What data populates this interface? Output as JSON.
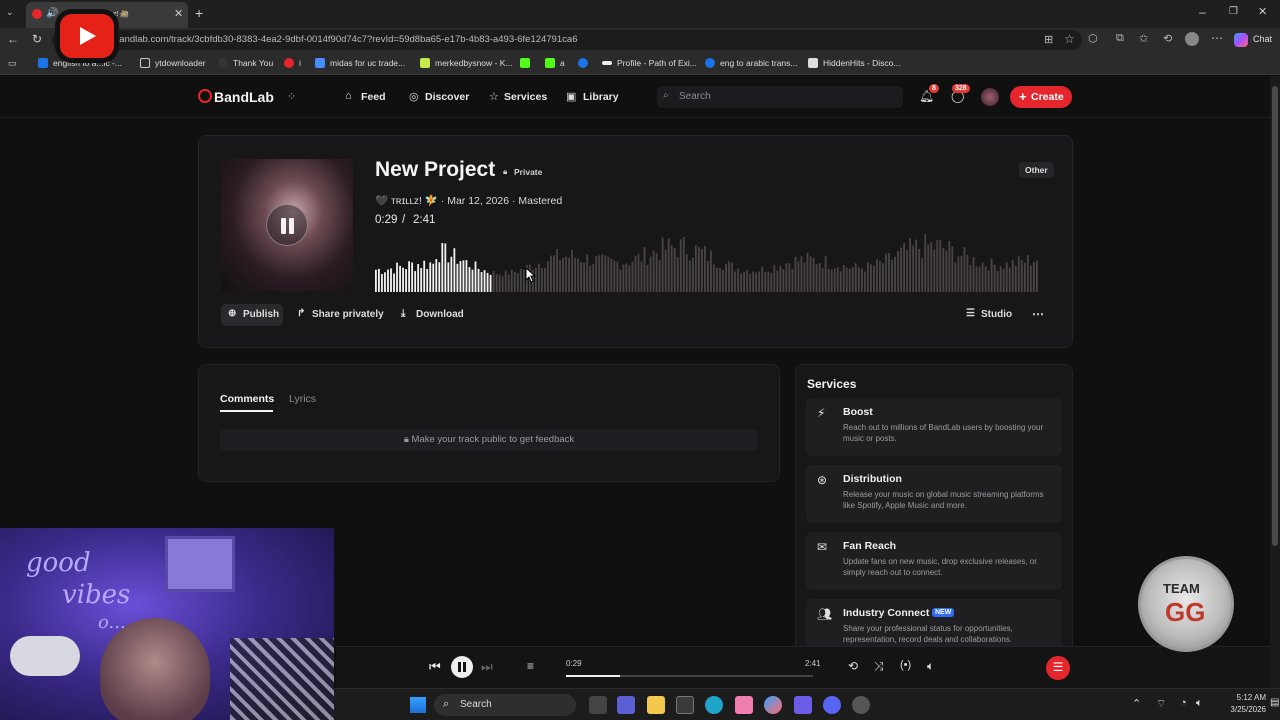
{
  "browser": {
    "tab_title": "N... ...d by ᴛʀɪʟʟᴢ! 🚵",
    "url": "bandlab.com/track/3cbfdb30-8383-4ea2-9dbf-0014f90d74c7?revId=59d8ba65-e17b-4b83-a493-6fe124791ca6",
    "bookmarks": [
      "english to a...ic -...",
      "ytdownloader",
      "Thank You",
      "i",
      "midas for uc trade...",
      "merkedbysnow - K...",
      "",
      "a",
      "",
      "Profile - Path of Exi...",
      "eng to arabic trans...",
      "HiddenHits - Disco..."
    ],
    "chat_label": "Chat"
  },
  "nav": {
    "logo": "BandLab",
    "links": [
      "Feed",
      "Discover",
      "Services",
      "Library"
    ],
    "search_placeholder": "Search",
    "notif_count": "8",
    "msg_count": "328",
    "create_label": "Create"
  },
  "track": {
    "title": "New Project",
    "privacy": "Private",
    "genre": "Other",
    "artist_line": "🖤 ᴛʀɪʟʟᴢ! 🧚 · Mar 12, 2026 · Mastered",
    "time_current": "0:29",
    "time_sep": "/",
    "time_total": "2:41",
    "progress": 0.22,
    "buttons": {
      "publish": "Publish",
      "share": "Share privately",
      "download": "Download",
      "studio": "Studio"
    }
  },
  "tabs": {
    "comments": "Comments",
    "lyrics": "Lyrics"
  },
  "comment_notice": "Make your track public to get feedback",
  "services": {
    "heading": "Services",
    "items": [
      {
        "title": "Boost",
        "desc": "Reach out to millions of BandLab users by boosting your music or posts."
      },
      {
        "title": "Distribution",
        "desc": "Release your music on global music streaming platforms like Spotify, Apple Music and more."
      },
      {
        "title": "Fan Reach",
        "desc": "Update fans on new music, drop exclusive releases, or simply reach out to connect."
      },
      {
        "title": "Industry Connect",
        "badge": "NEW",
        "desc": "Share your professional status for opportunities, representation, record deals and collaborations."
      }
    ]
  },
  "player": {
    "current": "0:29",
    "total": "2:41",
    "progress": 0.22
  },
  "overlay": {
    "webcam_text": [
      "good",
      "vibes",
      "o..."
    ],
    "team_badge": [
      "TEAM",
      "GG"
    ]
  },
  "taskbar": {
    "search": "Search",
    "time": "5:12 AM",
    "date": "3/25/2026"
  },
  "colors": {
    "accent": "#e5262c",
    "bg": "#101011",
    "card": "#171618"
  }
}
